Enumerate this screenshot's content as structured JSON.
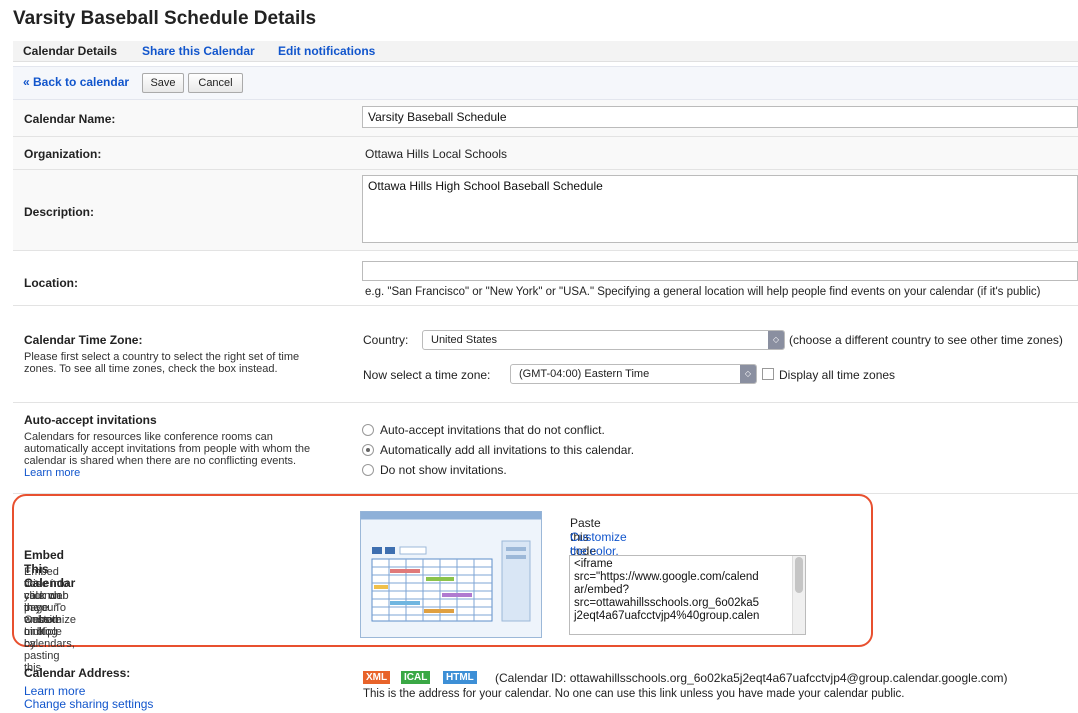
{
  "page_title": "Varsity Baseball Schedule Details",
  "tabs": [
    {
      "label": "Calendar Details",
      "active": true
    },
    {
      "label": "Share this Calendar",
      "active": false
    },
    {
      "label": "Edit notifications",
      "active": false
    }
  ],
  "toolbar": {
    "back_label": "« Back to calendar",
    "save_label": "Save",
    "cancel_label": "Cancel"
  },
  "calendar_name": {
    "label": "Calendar Name:",
    "value": "Varsity Baseball Schedule"
  },
  "organization": {
    "label": "Organization:",
    "value": "Ottawa Hills Local Schools"
  },
  "description": {
    "label": "Description:",
    "value": "Ottawa Hills High School Baseball Schedule"
  },
  "location": {
    "label": "Location:",
    "value": "",
    "hint": "e.g. \"San Francisco\" or \"New York\" or \"USA.\" Specifying a general location will help people find events on your calendar (if it's public)"
  },
  "time_zone": {
    "label": "Calendar Time Zone:",
    "desc_line1": "Please first select a country to select the right set of time",
    "desc_line2": "zones. To see all time zones, check the box instead.",
    "country_label": "Country:",
    "country_value": "United States",
    "country_hint": "(choose a different country to see other time zones)",
    "zone_label": "Now select a time zone:",
    "zone_value": "(GMT-04:00) Eastern Time",
    "display_all_label": "Display all time zones"
  },
  "auto_accept": {
    "label": "Auto-accept invitations",
    "desc_line1": "Calendars for resources like conference rooms can",
    "desc_line2": "automatically accept invitations from people with whom the",
    "desc_line3": "calendar is shared when there are no conflicting events.",
    "learn_more": "Learn more",
    "options": [
      {
        "label": "Auto-accept invitations that do not conflict.",
        "selected": false
      },
      {
        "label": "Automatically add all invitations to this calendar.",
        "selected": true
      },
      {
        "label": "Do not show invitations.",
        "selected": false
      }
    ]
  },
  "embed": {
    "label": "Embed This Calendar",
    "desc_line1": "Embed this calendar in your website or blog by pasting this",
    "desc_line2": "code into your web page. To embed multiple calendars,",
    "desc_line3": "click on the Customize Link",
    "paste_label": "Paste this code into your website.",
    "customize_link": "Customize the color, size, and other options",
    "code_lines": [
      "<iframe",
      "src=\"https://www.google.com/calend",
      "ar/embed?",
      "src=ottawahillsschools.org_6o02ka5",
      "j2eqt4a67uafcctvjp4%40group.calen"
    ]
  },
  "address": {
    "label": "Calendar Address:",
    "learn_more": "Learn more",
    "change_sharing": "Change sharing settings",
    "badges": {
      "xml": "XML",
      "ical": "ICAL",
      "html": "HTML"
    },
    "calendar_id": "(Calendar ID: ottawahillsschools.org_6o02ka5j2eqt4a67uafcctvjp4@group.calendar.google.com)",
    "note": "This is the address for your calendar. No one can use this link unless you have made your calendar public."
  },
  "colors": {
    "link": "#1155cc",
    "highlight": "#e8502f",
    "xml": "#e8632a",
    "ical": "#3aa845",
    "html": "#3d8fd6"
  }
}
